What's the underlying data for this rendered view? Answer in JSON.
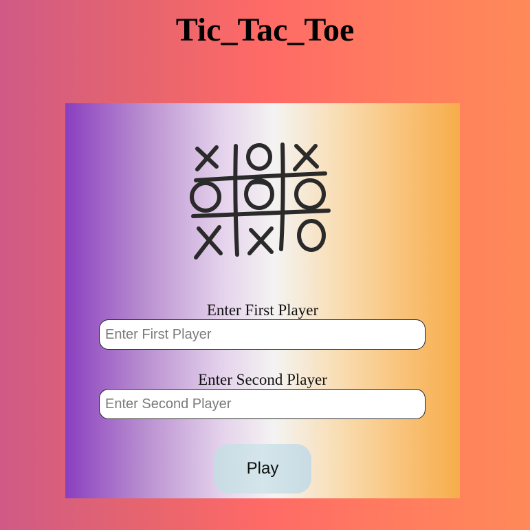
{
  "page": {
    "title": "Tic_Tac_Toe"
  },
  "form": {
    "board_image_icon": "tic-tac-toe-board-icon",
    "first_player": {
      "label": "Enter First Player",
      "placeholder": "Enter First Player",
      "value": ""
    },
    "second_player": {
      "label": "Enter Second Player",
      "placeholder": "Enter Second Player",
      "value": ""
    },
    "play_label": "Play"
  },
  "colors": {
    "page_gradient": [
      "#cf5a86",
      "#ff6a66",
      "#ff8958"
    ],
    "card_gradient": [
      "#8a3fbf",
      "#f4f3f2",
      "#f6ad4a"
    ],
    "button_bg": "#d4e6ea"
  }
}
